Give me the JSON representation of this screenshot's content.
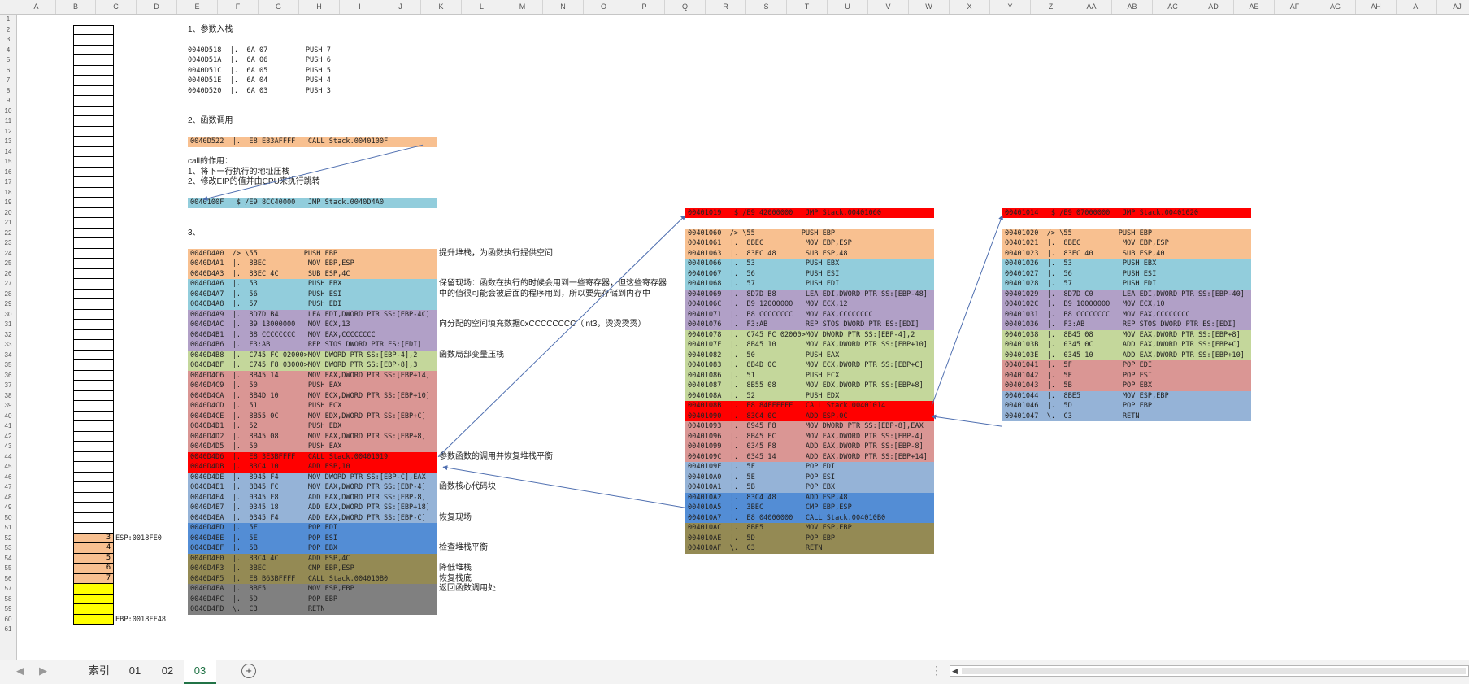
{
  "sheet": {
    "columns": [
      "A",
      "B",
      "C",
      "D",
      "E",
      "F",
      "G",
      "H",
      "I",
      "J",
      "K",
      "L",
      "M",
      "N",
      "O",
      "P",
      "Q",
      "R",
      "S",
      "T",
      "U",
      "V",
      "W",
      "X",
      "Y",
      "Z",
      "AA",
      "AB",
      "AC",
      "AD",
      "AE",
      "AF",
      "AG",
      "AH",
      "AI",
      "AJ"
    ],
    "rows": [
      "1",
      "2",
      "3",
      "4",
      "5",
      "6",
      "7",
      "8",
      "9",
      "10",
      "11",
      "12",
      "13",
      "14",
      "15",
      "16",
      "17",
      "18",
      "19",
      "20",
      "21",
      "22",
      "23",
      "24",
      "25",
      "26",
      "27",
      "28",
      "29",
      "30",
      "31",
      "32",
      "33",
      "34",
      "35",
      "36",
      "37",
      "38",
      "39",
      "40",
      "41",
      "42",
      "43",
      "44",
      "45",
      "46",
      "47",
      "48",
      "49",
      "50",
      "51",
      "52",
      "53",
      "54",
      "55",
      "56",
      "57",
      "58",
      "59",
      "60",
      "61"
    ]
  },
  "colors": {
    "orange": "#f8c090",
    "cyan": "#92cddc",
    "purple": "#b1a0c7",
    "green": "#c4d79b",
    "rose": "#da9694",
    "red": "#ff0000",
    "blue_light": "#95b3d7",
    "blue_mid": "#538dd5",
    "olive": "#948a54",
    "grey": "#808080",
    "yellow": "#ffff00",
    "arrow": "#4f6fb0"
  },
  "stack": {
    "esp_label": "ESP:0018FE0",
    "ebp_label": "EBP:0018FF48",
    "values": [
      "3",
      "4",
      "5",
      "6",
      "7"
    ]
  },
  "sections": {
    "s1_title": "1、参数入栈",
    "s1_lines": [
      "0040D518  |.  6A 07         PUSH 7",
      "0040D51A  |.  6A 06         PUSH 6",
      "0040D51C  |.  6A 05         PUSH 5",
      "0040D51E  |.  6A 04         PUSH 4",
      "0040D520  |.  6A 03         PUSH 3"
    ],
    "s2_title": "2、函数调用",
    "s2_call": "0040D522  |.  E8 E83AFFFF   CALL Stack.0040100F",
    "call_notes": [
      "call的作用：",
      "1、将下一行执行的地址压栈",
      "2、修改EIP的值并由CPU来执行跳转"
    ],
    "s2_jmp": "0040100F   $ /E9 8CC40000   JMP Stack.0040D4A0",
    "s3_title": "3、"
  },
  "block_main": [
    {
      "text": "0040D4A0  /> \\55           PUSH EBP",
      "color": "orange"
    },
    {
      "text": "0040D4A1  |.  8BEC          MOV EBP,ESP",
      "color": "orange"
    },
    {
      "text": "0040D4A3  |.  83EC 4C       SUB ESP,4C",
      "color": "orange"
    },
    {
      "text": "0040D4A6  |.  53            PUSH EBX",
      "color": "cyan"
    },
    {
      "text": "0040D4A7  |.  56            PUSH ESI",
      "color": "cyan"
    },
    {
      "text": "0040D4A8  |.  57            PUSH EDI",
      "color": "cyan"
    },
    {
      "text": "0040D4A9  |.  8D7D B4       LEA EDI,DWORD PTR SS:[EBP-4C]",
      "color": "purple"
    },
    {
      "text": "0040D4AC  |.  B9 13000000   MOV ECX,13",
      "color": "purple"
    },
    {
      "text": "0040D4B1  |.  B8 CCCCCCCC   MOV EAX,CCCCCCCC",
      "color": "purple"
    },
    {
      "text": "0040D4B6  |.  F3:AB         REP STOS DWORD PTR ES:[EDI]",
      "color": "purple"
    },
    {
      "text": "0040D4B8  |.  C745 FC 02000>MOV DWORD PTR SS:[EBP-4],2",
      "color": "green"
    },
    {
      "text": "0040D4BF  |.  C745 F8 03000>MOV DWORD PTR SS:[EBP-8],3",
      "color": "green"
    },
    {
      "text": "0040D4C6  |.  8B45 14       MOV EAX,DWORD PTR SS:[EBP+14]",
      "color": "rose"
    },
    {
      "text": "0040D4C9  |.  50            PUSH EAX",
      "color": "rose"
    },
    {
      "text": "0040D4CA  |.  8B4D 10       MOV ECX,DWORD PTR SS:[EBP+10]",
      "color": "rose"
    },
    {
      "text": "0040D4CD  |.  51            PUSH ECX",
      "color": "rose"
    },
    {
      "text": "0040D4CE  |.  8B55 0C       MOV EDX,DWORD PTR SS:[EBP+C]",
      "color": "rose"
    },
    {
      "text": "0040D4D1  |.  52            PUSH EDX",
      "color": "rose"
    },
    {
      "text": "0040D4D2  |.  8B45 08       MOV EAX,DWORD PTR SS:[EBP+8]",
      "color": "rose"
    },
    {
      "text": "0040D4D5  |.  50            PUSH EAX",
      "color": "rose"
    },
    {
      "text": "0040D4D6  |.  E8 3E3BFFFF   CALL Stack.00401019",
      "color": "red"
    },
    {
      "text": "0040D4DB  |.  83C4 10       ADD ESP,10",
      "color": "red"
    },
    {
      "text": "0040D4DE  |.  8945 F4       MOV DWORD PTR SS:[EBP-C],EAX",
      "color": "blue_light"
    },
    {
      "text": "0040D4E1  |.  8B45 FC       MOV EAX,DWORD PTR SS:[EBP-4]",
      "color": "blue_light"
    },
    {
      "text": "0040D4E4  |.  0345 F8       ADD EAX,DWORD PTR SS:[EBP-8]",
      "color": "blue_light"
    },
    {
      "text": "0040D4E7  |.  0345 18       ADD EAX,DWORD PTR SS:[EBP+18]",
      "color": "blue_light"
    },
    {
      "text": "0040D4EA  |.  0345 F4       ADD EAX,DWORD PTR SS:[EBP-C]",
      "color": "blue_light"
    },
    {
      "text": "0040D4ED  |.  5F            POP EDI",
      "color": "blue_mid"
    },
    {
      "text": "0040D4EE  |.  5E            POP ESI",
      "color": "blue_mid"
    },
    {
      "text": "0040D4EF  |.  5B            POP EBX",
      "color": "blue_mid"
    },
    {
      "text": "0040D4F0  |.  83C4 4C       ADD ESP,4C",
      "color": "olive"
    },
    {
      "text": "0040D4F3  |.  3BEC          CMP EBP,ESP",
      "color": "olive"
    },
    {
      "text": "0040D4F5  |.  E8 B63BFFFF   CALL Stack.004010B0",
      "color": "olive"
    },
    {
      "text": "0040D4FA  |.  8BE5          MOV ESP,EBP",
      "color": "grey"
    },
    {
      "text": "0040D4FC  |.  5D            POP EBP",
      "color": "grey"
    },
    {
      "text": "0040D4FD  \\.  C3            RETN",
      "color": "grey"
    }
  ],
  "notes_main": [
    {
      "row": 24,
      "text": "提升堆栈，为函数执行提供空间"
    },
    {
      "row": 27,
      "text": "保留现场：函数在执行的时候会用到一些寄存器，但这些寄存器"
    },
    {
      "row": 28,
      "text": "中的值很可能会被后面的程序用到，所以要先存储到内存中"
    },
    {
      "row": 31,
      "text": "向分配的空间填充数据0xCCCCCCCC（int3，烫烫烫烫）"
    },
    {
      "row": 34,
      "text": "函数局部变量压栈"
    },
    {
      "row": 44,
      "text": "参数函数的调用并恢复堆栈平衡"
    },
    {
      "row": 47,
      "text": "函数核心代码块"
    },
    {
      "row": 50,
      "text": "恢复现场"
    },
    {
      "row": 53,
      "text": "检查堆栈平衡"
    },
    {
      "row": 55,
      "text": "降低堆栈"
    },
    {
      "row": 56,
      "text": "恢复栈底"
    },
    {
      "row": 57,
      "text": "返回函数调用处"
    }
  ],
  "block2_jmp": "00401019   $ /E9 42000000   JMP Stack.00401060",
  "block2": [
    {
      "text": "00401060  /> \\55           PUSH EBP",
      "color": "orange"
    },
    {
      "text": "00401061  |.  8BEC          MOV EBP,ESP",
      "color": "orange"
    },
    {
      "text": "00401063  |.  83EC 48       SUB ESP,48",
      "color": "orange"
    },
    {
      "text": "00401066  |.  53            PUSH EBX",
      "color": "cyan"
    },
    {
      "text": "00401067  |.  56            PUSH ESI",
      "color": "cyan"
    },
    {
      "text": "00401068  |.  57            PUSH EDI",
      "color": "cyan"
    },
    {
      "text": "00401069  |.  8D7D B8       LEA EDI,DWORD PTR SS:[EBP-48]",
      "color": "purple"
    },
    {
      "text": "0040106C  |.  B9 12000000   MOV ECX,12",
      "color": "purple"
    },
    {
      "text": "00401071  |.  B8 CCCCCCCC   MOV EAX,CCCCCCCC",
      "color": "purple"
    },
    {
      "text": "00401076  |.  F3:AB         REP STOS DWORD PTR ES:[EDI]",
      "color": "purple"
    },
    {
      "text": "00401078  |.  C745 FC 02000>MOV DWORD PTR SS:[EBP-4],2",
      "color": "green"
    },
    {
      "text": "0040107F  |.  8B45 10       MOV EAX,DWORD PTR SS:[EBP+10]",
      "color": "green"
    },
    {
      "text": "00401082  |.  50            PUSH EAX",
      "color": "green"
    },
    {
      "text": "00401083  |.  8B4D 0C       MOV ECX,DWORD PTR SS:[EBP+C]",
      "color": "green"
    },
    {
      "text": "00401086  |.  51            PUSH ECX",
      "color": "green"
    },
    {
      "text": "00401087  |.  8B55 08       MOV EDX,DWORD PTR SS:[EBP+8]",
      "color": "green"
    },
    {
      "text": "0040108A  |.  52            PUSH EDX",
      "color": "green"
    },
    {
      "text": "0040108B  |.  E8 84FFFFFF   CALL Stack.00401014",
      "color": "red"
    },
    {
      "text": "00401090  |.  83C4 0C       ADD ESP,0C",
      "color": "red"
    },
    {
      "text": "00401093  |.  8945 F8       MOV DWORD PTR SS:[EBP-8],EAX",
      "color": "rose"
    },
    {
      "text": "00401096  |.  8B45 FC       MOV EAX,DWORD PTR SS:[EBP-4]",
      "color": "rose"
    },
    {
      "text": "00401099  |.  0345 F8       ADD EAX,DWORD PTR SS:[EBP-8]",
      "color": "rose"
    },
    {
      "text": "0040109C  |.  0345 14       ADD EAX,DWORD PTR SS:[EBP+14]",
      "color": "rose"
    },
    {
      "text": "0040109F  |.  5F            POP EDI",
      "color": "blue_light"
    },
    {
      "text": "004010A0  |.  5E            POP ESI",
      "color": "blue_light"
    },
    {
      "text": "004010A1  |.  5B            POP EBX",
      "color": "blue_light"
    },
    {
      "text": "004010A2  |.  83C4 48       ADD ESP,48",
      "color": "blue_mid"
    },
    {
      "text": "004010A5  |.  3BEC          CMP EBP,ESP",
      "color": "blue_mid"
    },
    {
      "text": "004010A7  |.  E8 04000000   CALL Stack.004010B0",
      "color": "blue_mid"
    },
    {
      "text": "004010AC  |.  8BE5          MOV ESP,EBP",
      "color": "olive"
    },
    {
      "text": "004010AE  |.  5D            POP EBP",
      "color": "olive"
    },
    {
      "text": "004010AF  \\.  C3            RETN",
      "color": "olive"
    }
  ],
  "block3_jmp": "00401014   $ /E9 07000000   JMP Stack.00401020",
  "block3": [
    {
      "text": "00401020  /> \\55           PUSH EBP",
      "color": "orange"
    },
    {
      "text": "00401021  |.  8BEC          MOV EBP,ESP",
      "color": "orange"
    },
    {
      "text": "00401023  |.  83EC 40       SUB ESP,40",
      "color": "orange"
    },
    {
      "text": "00401026  |.  53            PUSH EBX",
      "color": "cyan"
    },
    {
      "text": "00401027  |.  56            PUSH ESI",
      "color": "cyan"
    },
    {
      "text": "00401028  |.  57            PUSH EDI",
      "color": "cyan"
    },
    {
      "text": "00401029  |.  8D7D C0       LEA EDI,DWORD PTR SS:[EBP-40]",
      "color": "purple"
    },
    {
      "text": "0040102C  |.  B9 10000000   MOV ECX,10",
      "color": "purple"
    },
    {
      "text": "00401031  |.  B8 CCCCCCCC   MOV EAX,CCCCCCCC",
      "color": "purple"
    },
    {
      "text": "00401036  |.  F3:AB         REP STOS DWORD PTR ES:[EDI]",
      "color": "purple"
    },
    {
      "text": "00401038  |.  8B45 08       MOV EAX,DWORD PTR SS:[EBP+8]",
      "color": "green"
    },
    {
      "text": "0040103B  |.  0345 0C       ADD EAX,DWORD PTR SS:[EBP+C]",
      "color": "green"
    },
    {
      "text": "0040103E  |.  0345 10       ADD EAX,DWORD PTR SS:[EBP+10]",
      "color": "green"
    },
    {
      "text": "00401041  |.  5F            POP EDI",
      "color": "rose"
    },
    {
      "text": "00401042  |.  5E            POP ESI",
      "color": "rose"
    },
    {
      "text": "00401043  |.  5B            POP EBX",
      "color": "rose"
    },
    {
      "text": "00401044  |.  8BE5          MOV ESP,EBP",
      "color": "blue_light"
    },
    {
      "text": "00401046  |.  5D            POP EBP",
      "color": "blue_light"
    },
    {
      "text": "00401047  \\.  C3            RETN",
      "color": "blue_light"
    }
  ],
  "tabs": {
    "prev": "◀",
    "next": "▶",
    "items": [
      "索引",
      "01",
      "02",
      "03"
    ],
    "active": "03",
    "add": "+",
    "more": "⋮",
    "scroll_left": "◀"
  }
}
